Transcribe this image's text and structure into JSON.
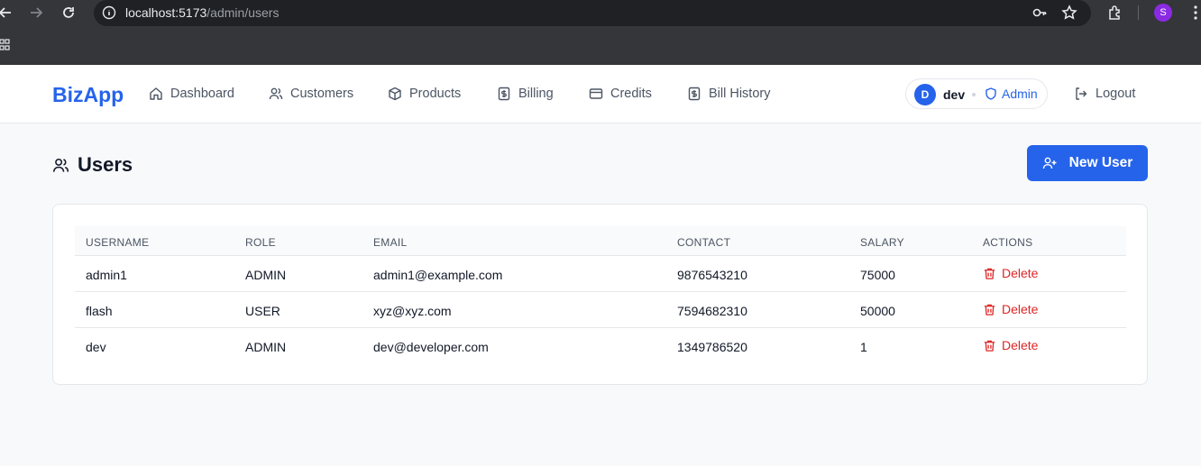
{
  "browser": {
    "url_host": "localhost:5173",
    "url_path": "/admin/users",
    "profile_initial": "S"
  },
  "app": {
    "brand": "BizApp",
    "nav": [
      {
        "label": "Dashboard",
        "icon": "home-icon"
      },
      {
        "label": "Customers",
        "icon": "users-icon"
      },
      {
        "label": "Products",
        "icon": "package-icon"
      },
      {
        "label": "Billing",
        "icon": "dollar-receipt-icon"
      },
      {
        "label": "Credits",
        "icon": "credit-card-icon"
      },
      {
        "label": "Bill History",
        "icon": "dollar-receipt-icon"
      }
    ],
    "user": {
      "initial": "D",
      "name": "dev",
      "role": "Admin"
    },
    "logout_label": "Logout"
  },
  "page": {
    "title": "Users",
    "new_button_label": "New User"
  },
  "table": {
    "headers": [
      "USERNAME",
      "ROLE",
      "EMAIL",
      "CONTACT",
      "SALARY",
      "ACTIONS"
    ],
    "rows": [
      {
        "username": "admin1",
        "role": "ADMIN",
        "email": "admin1@example.com",
        "contact": "9876543210",
        "salary": "75000",
        "action": "Delete"
      },
      {
        "username": "flash",
        "role": "USER",
        "email": "xyz@xyz.com",
        "contact": "7594682310",
        "salary": "50000",
        "action": "Delete"
      },
      {
        "username": "dev",
        "role": "ADMIN",
        "email": "dev@developer.com",
        "contact": "1349786520",
        "salary": "1",
        "action": "Delete"
      }
    ]
  },
  "colors": {
    "accent": "#2563eb",
    "danger": "#dc2626"
  }
}
